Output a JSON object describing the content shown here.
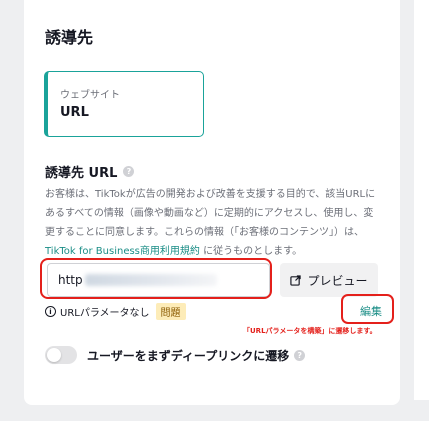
{
  "section_title": "誘導先",
  "destination_card": {
    "subtitle": "ウェブサイト",
    "value": "URL"
  },
  "url_section": {
    "label": "誘導先 URL",
    "description_before_link": "お客様は、TikTokが広告の開発および改善を支援する目的で、該当URLにあるすべての情報（画像や動画など）に定期的にアクセスし、使用し、変更することに同意します。これらの情報（「お客様のコンテンツ」）は、",
    "description_link": "TikTok for Business商用利用規約",
    "description_after_link": "に従うものとします。",
    "input_value": "http",
    "preview_button": "プレビュー"
  },
  "params": {
    "status_text": "URLパラメータなし",
    "badge": "問題",
    "edit_link": "編集",
    "annotation": "「URLパラメータを構築」に遷移します。"
  },
  "deeplink": {
    "label": "ユーザーをまずディープリンクに遷移",
    "enabled": false
  },
  "colors": {
    "accent": "#1aa39a",
    "highlight": "#e4201b",
    "badge_bg": "#fdecb8"
  }
}
